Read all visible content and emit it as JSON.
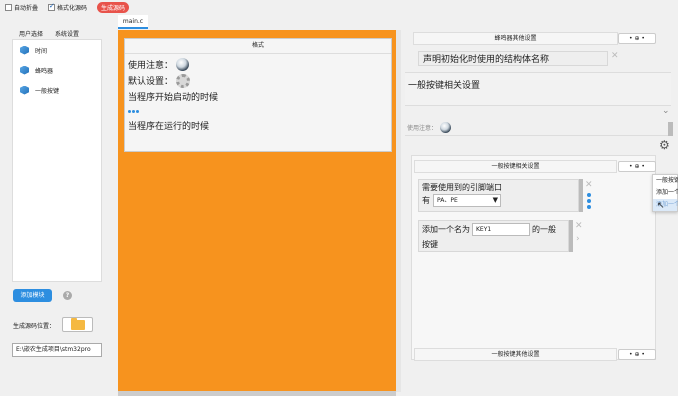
{
  "toolbar": {
    "auto_fold": "自动折叠",
    "format_code": "格式化源码",
    "generate": "生成源码"
  },
  "left": {
    "tabs": [
      "用户选择",
      "系统设置"
    ],
    "items": [
      "时间",
      "蜂鸣器",
      "一般按键"
    ],
    "add_module": "添加模块",
    "help": "?",
    "gen_location_label": "生成源码位置：",
    "path": "E:\\嵌农生成项目\\stm32pro"
  },
  "editor": {
    "file_tab": "main.c",
    "card_title": "格式",
    "lines": {
      "use_note": "使用注意：",
      "default_settings": "默认设置：",
      "on_start": "当程序开始启动的时候",
      "on_running": "当程序在运行的时候"
    }
  },
  "right": {
    "buzzer_other": "蜂鸣器其他设置",
    "btn_label": "• ⊕ •",
    "struct_decl": "声明初始化时使用的结构体名称",
    "key_section_title": "一般按键相关设置",
    "use_note": "使用注意：",
    "key_settings_bar": "一般按键相关设置",
    "pins_label_1": "需要使用到的引脚端口",
    "pins_label_2": "有",
    "pins_select": "PA、PE",
    "add_key_prefix": "添加一个名为",
    "key_input": "KEY1",
    "add_key_suffix": "的一般",
    "add_key_line2": "按键",
    "key_other": "一般按键其他设置",
    "popup": [
      "一般按键",
      "添加一个",
      "添加一个"
    ]
  },
  "colors": {
    "orange": "#f7931e",
    "accent": "#2d8ee0",
    "generate": "#e8534b"
  }
}
